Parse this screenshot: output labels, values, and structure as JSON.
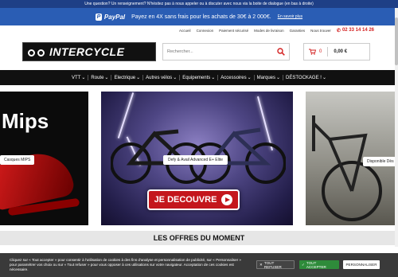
{
  "topbar": {
    "text": "Une question? Un renseignement? N'hésitez pas à nous appeler ou à discuter avec nous via la boite de dialogue (en bas à droite)"
  },
  "paypal": {
    "brand": "PayPal",
    "offer": "Payez en 4X sans frais pour les achats de 30€ à 2 000€.",
    "link": "En savoir plus",
    "icon": "paypal-icon"
  },
  "utility": {
    "links": [
      "Accueil",
      "Connexion",
      "Paiement sécurisé",
      "Modes de livraison",
      "Garanties",
      "Nous trouver"
    ],
    "phone": "02 33 14 14 26"
  },
  "header": {
    "logo_text": "INTERCYCLE",
    "search_placeholder": "Rechercher...",
    "cart_count": "0",
    "cart_total": "0,00 €"
  },
  "nav": {
    "items": [
      {
        "label": "VTT",
        "dropdown": true
      },
      {
        "label": "Route",
        "dropdown": true
      },
      {
        "label": "Electrique",
        "dropdown": true
      },
      {
        "label": "Autres vélos",
        "dropdown": true
      },
      {
        "label": "Equipements",
        "dropdown": true
      },
      {
        "label": "Accessoires",
        "dropdown": true
      },
      {
        "label": "Marques",
        "dropdown": true
      },
      {
        "label": "DÉSTOCKAGE !",
        "dropdown": true
      }
    ]
  },
  "slider": {
    "left": {
      "title": "Mips",
      "label": "Casques MIPS"
    },
    "center": {
      "label": "Defy & Avail Advanced E+ Elite",
      "button": "JE DECOUVRE"
    },
    "right": {
      "label": "Disponible Dès"
    }
  },
  "offers": {
    "title": "LES OFFRES DU MOMENT"
  },
  "cookie": {
    "text": "Cliquez sur « Tout accepter » pour consentir à l'utilisation de cookies à des fins d'analyse et personnalisation de publicité, sur « Personnaliser » pour paramétrer vos choix ou sur « Tout refuser » pour vous opposer à ces utilisations sur votre navigateur. Acceptation de ces cookies est nécessaire.",
    "refuse": "TOUT REFUSER",
    "accept": "TOUT ACCEPTER",
    "customize": "PERSONNALISER"
  },
  "colors": {
    "paypal_blue": "#2a5db4",
    "accent_red": "#d32020",
    "nav_black": "#111111",
    "accept_green": "#2e8b3a"
  }
}
